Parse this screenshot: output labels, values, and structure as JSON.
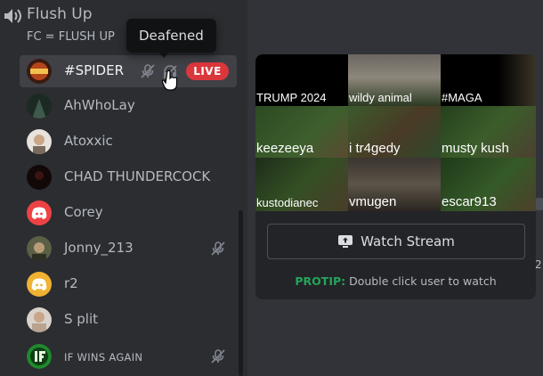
{
  "channel": {
    "name": "Flush Up",
    "topic": "FC = FLUSH UP"
  },
  "tooltip": {
    "text": "Deafened"
  },
  "users": [
    {
      "name": "#SPIDER",
      "live_label": "LIVE",
      "muted": true,
      "deafened": true,
      "active": true
    },
    {
      "name": "AhWhoLay"
    },
    {
      "name": "Atoxxic"
    },
    {
      "name": "CHAD THUNDERCOCK"
    },
    {
      "name": "Corey"
    },
    {
      "name": "Jonny_213",
      "muted": true
    },
    {
      "name": "r2"
    },
    {
      "name": "S plit"
    },
    {
      "name": "IF WINS AGAIN",
      "muted": true
    }
  ],
  "stream_preview": {
    "tiles": [
      {
        "label": "TRUMP 2024"
      },
      {
        "label": "wildy animal"
      },
      {
        "label": "#MAGA"
      },
      {
        "label": "keezeeya"
      },
      {
        "label": "i tr4gedy"
      },
      {
        "label": "musty kush"
      },
      {
        "label": "kustodianec"
      },
      {
        "label": "vmugen"
      },
      {
        "label": "escar913"
      }
    ]
  },
  "watch_button": {
    "label": "Watch Stream"
  },
  "protip": {
    "label": "PROTIP:",
    "text": " Double click user to watch"
  },
  "edge_text": "2",
  "colors": {
    "live": "#da373c",
    "protip": "#23a55a",
    "corey_avatar": "#ed4245",
    "r2_avatar": "#f0b232"
  }
}
